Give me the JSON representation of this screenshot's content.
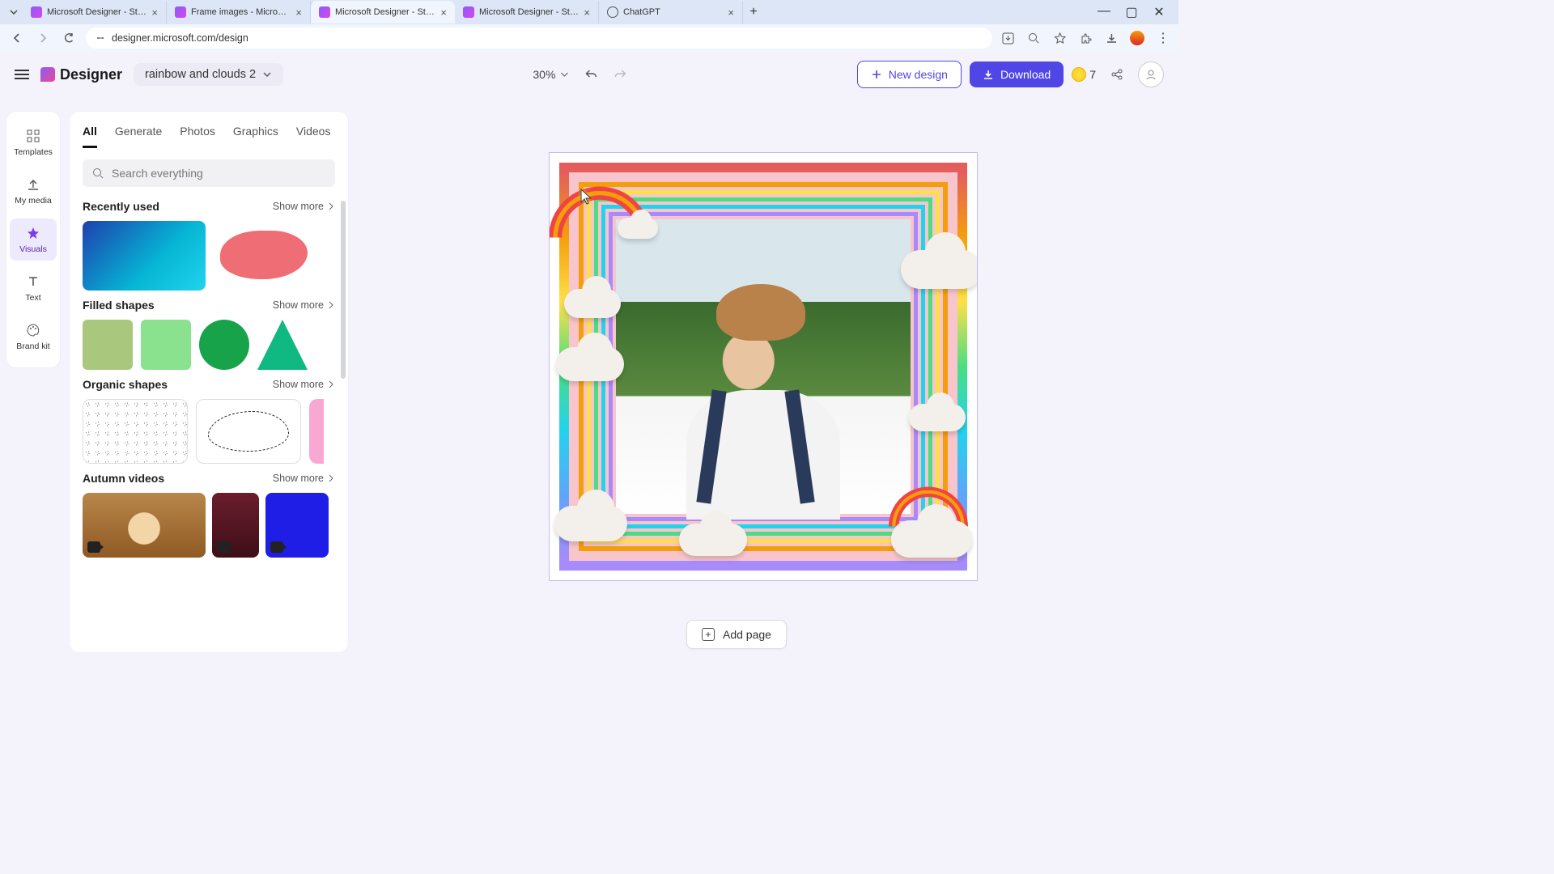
{
  "browser": {
    "tabs": [
      {
        "title": "Microsoft Designer - Stunning"
      },
      {
        "title": "Frame images - Microsoft Des"
      },
      {
        "title": "Microsoft Designer - Stunning"
      },
      {
        "title": "Microsoft Designer - Stunning"
      },
      {
        "title": "ChatGPT"
      }
    ],
    "url": "designer.microsoft.com/design"
  },
  "header": {
    "brand": "Designer",
    "doc_name": "rainbow and clouds 2",
    "zoom": "30%",
    "new_design": "New design",
    "download": "Download",
    "credits": "7"
  },
  "rail": {
    "templates": "Templates",
    "my_media": "My media",
    "visuals": "Visuals",
    "text": "Text",
    "brand_kit": "Brand kit"
  },
  "panel": {
    "tabs": {
      "all": "All",
      "generate": "Generate",
      "photos": "Photos",
      "graphics": "Graphics",
      "videos": "Videos"
    },
    "search_placeholder": "Search everything",
    "show_more": "Show more",
    "sections": {
      "recently_used": "Recently used",
      "filled_shapes": "Filled shapes",
      "organic_shapes": "Organic shapes",
      "autumn_videos": "Autumn videos"
    }
  },
  "footer": {
    "add_page": "Add page"
  }
}
